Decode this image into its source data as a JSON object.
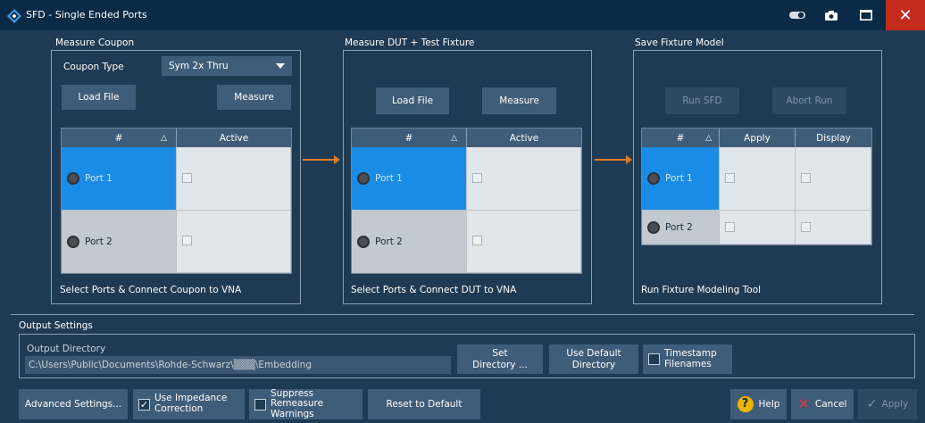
{
  "window": {
    "title": "SFD - Single Ended Ports"
  },
  "icons": {
    "logo": "rohde-schwarz-logo",
    "toggle": "toggle-icon",
    "camera": "camera-icon",
    "maximize": "maximize-icon",
    "close": "close-icon",
    "close_glyph": "✕"
  },
  "colors": {
    "accent": "#1a8ce6",
    "arrow": "#e07a2a",
    "close": "#c42b1c",
    "help": "#f0b400"
  },
  "coupon": {
    "title": "Measure Coupon",
    "type_label": "Coupon Type",
    "type_value": "Sym 2x Thru",
    "load_label": "Load File",
    "measure_label": "Measure",
    "col_num": "#",
    "col_active": "Active",
    "sort_glyph": "△",
    "port1": "Port 1",
    "port2": "Port 2",
    "hint": "Select Ports & Connect Coupon to VNA"
  },
  "dut": {
    "title": "Measure DUT + Test Fixture",
    "load_label": "Load File",
    "measure_label": "Measure",
    "col_num": "#",
    "col_active": "Active",
    "sort_glyph": "△",
    "port1": "Port 1",
    "port2": "Port 2",
    "hint": "Select Ports & Connect DUT to VNA"
  },
  "fixture": {
    "title": "Save Fixture Model",
    "run_label": "Run SFD",
    "abort_label": "Abort Run",
    "col_num": "#",
    "col_apply": "Apply",
    "col_display": "Display",
    "sort_glyph": "△",
    "port1": "Port 1",
    "port2": "Port 2",
    "hint": "Run Fixture Modeling Tool"
  },
  "output": {
    "section_label": "Output Settings",
    "dir_label": "Output Directory",
    "dir_value": "C:\\Users\\Public\\Documents\\Rohde-Schwarz\\▒▒▒\\Embedding",
    "set_dir_l1": "Set",
    "set_dir_l2": "Directory ...",
    "use_default_l1": "Use Default",
    "use_default_l2": "Directory",
    "timestamp_l1": "Timestamp",
    "timestamp_l2": "Filenames"
  },
  "footer": {
    "advanced": "Advanced Settings...",
    "impedance_l1": "Use Impedance",
    "impedance_l2": "Correction",
    "impedance_checked": true,
    "check_glyph": "✓",
    "suppress_l1": "Suppress Remeasure",
    "suppress_l2": "Warnings",
    "suppress_checked": false,
    "reset": "Reset to Default",
    "help": "Help",
    "help_glyph": "?",
    "cancel": "Cancel",
    "cancel_glyph": "✕",
    "apply": "Apply",
    "apply_glyph": "✓"
  }
}
